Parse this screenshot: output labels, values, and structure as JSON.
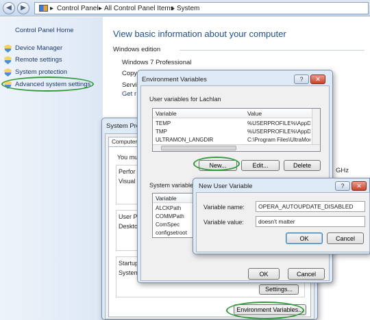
{
  "breadcrumb": {
    "items": [
      "Control Panel",
      "All Control Panel Items",
      "System"
    ]
  },
  "sidebar": {
    "home": "Control Panel Home",
    "items": [
      "Device Manager",
      "Remote settings",
      "System protection",
      "Advanced system settings"
    ]
  },
  "main": {
    "title": "View basic information about your computer",
    "windows_edition_label": "Windows edition",
    "edition": "Windows 7 Professional",
    "copy_partial": "Copy",
    "servi_partial": "Servi",
    "get_partial": "Get r",
    "ghz_partial": "GHz"
  },
  "sysprops": {
    "title": "System Pro",
    "tab": "Computer",
    "you_must": "You mus",
    "perf": "Perfor",
    "visual": "Visual",
    "user_prof": "User P",
    "desktop": "Deskto",
    "startup": "Startup",
    "system": "System",
    "settings_button": "Settings...",
    "env_button": "Environment Variables..."
  },
  "envvars": {
    "title": "Environment Variables",
    "user_label": "User variables for Lachlan",
    "col_variable": "Variable",
    "col_value": "Value",
    "user_rows": [
      {
        "variable": "TEMP",
        "value": "%USERPROFILE%\\AppDa"
      },
      {
        "variable": "TMP",
        "value": "%USERPROFILE%\\AppDa"
      },
      {
        "variable": "ULTRAMON_LANGDIR",
        "value": "C:\\Program Files\\UltraMon"
      }
    ],
    "new_button": "New...",
    "edit_button": "Edit...",
    "delete_button": "Delete",
    "system_label": "System variables",
    "system_rows": [
      "ALCKPath",
      "COMMPath",
      "ComSpec",
      "configsetroot"
    ],
    "ok_button": "OK",
    "cancel_button": "Cancel"
  },
  "newvar": {
    "title": "New User Variable",
    "name_label": "Variable name:",
    "name_value": "OPERA_AUTOUPDATE_DISABLED",
    "value_label": "Variable value:",
    "value_value": "doesn't matter",
    "ok_button": "OK",
    "cancel_button": "Cancel"
  },
  "colors": {
    "highlight": "#2f9a3a",
    "link": "#1e3a6e",
    "title_blue": "#1f4e8c"
  }
}
